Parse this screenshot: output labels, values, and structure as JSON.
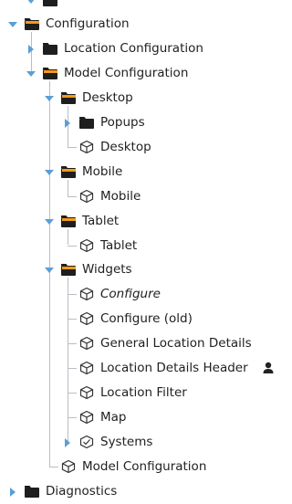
{
  "tree": {
    "items": [
      {
        "label": "",
        "level": 1,
        "kind": "folder",
        "twisty": "expanded",
        "italic": false,
        "top_cut": true
      },
      {
        "label": "Configuration",
        "level": 0,
        "kind": "folder-open",
        "twisty": "expanded",
        "italic": false
      },
      {
        "label": "Location Configuration",
        "level": 1,
        "kind": "folder",
        "twisty": "collapsed",
        "italic": false
      },
      {
        "label": "Model Configuration",
        "level": 1,
        "kind": "folder-open",
        "twisty": "expanded",
        "italic": false
      },
      {
        "label": "Desktop",
        "level": 2,
        "kind": "folder-open",
        "twisty": "expanded",
        "italic": false
      },
      {
        "label": "Popups",
        "level": 3,
        "kind": "folder",
        "twisty": "collapsed",
        "italic": false
      },
      {
        "label": "Desktop",
        "level": 3,
        "kind": "view",
        "twisty": "none",
        "italic": false
      },
      {
        "label": "Mobile",
        "level": 2,
        "kind": "folder-open",
        "twisty": "expanded",
        "italic": false
      },
      {
        "label": "Mobile",
        "level": 3,
        "kind": "view",
        "twisty": "none",
        "italic": false
      },
      {
        "label": "Tablet",
        "level": 2,
        "kind": "folder-open",
        "twisty": "expanded",
        "italic": false
      },
      {
        "label": "Tablet",
        "level": 3,
        "kind": "view",
        "twisty": "none",
        "italic": false
      },
      {
        "label": "Widgets",
        "level": 2,
        "kind": "folder-open",
        "twisty": "expanded",
        "italic": false
      },
      {
        "label": "Configure",
        "level": 3,
        "kind": "view",
        "twisty": "none",
        "italic": true
      },
      {
        "label": "Configure (old)",
        "level": 3,
        "kind": "view",
        "twisty": "none",
        "italic": false
      },
      {
        "label": "General Location Details",
        "level": 3,
        "kind": "view",
        "twisty": "none",
        "italic": false
      },
      {
        "label": "Location Details Header",
        "level": 3,
        "kind": "view",
        "twisty": "none",
        "italic": false,
        "badge": "user-icon"
      },
      {
        "label": "Location Filter",
        "level": 3,
        "kind": "view",
        "twisty": "none",
        "italic": false
      },
      {
        "label": "Map",
        "level": 3,
        "kind": "view",
        "twisty": "none",
        "italic": false
      },
      {
        "label": "Systems",
        "level": 3,
        "kind": "view-checked",
        "twisty": "collapsed",
        "italic": false
      },
      {
        "label": "Model Configuration",
        "level": 2,
        "kind": "view",
        "twisty": "none",
        "italic": false
      },
      {
        "label": "Diagnostics",
        "level": 0,
        "kind": "folder",
        "twisty": "collapsed",
        "italic": false
      }
    ]
  },
  "colors": {
    "folder": "#1e1e1e",
    "folder_open_top": "#f39a1b",
    "twisty": "#5a9fd6",
    "guide": "#b9bec4",
    "view_stroke": "#333333",
    "text": "#1f1f1f"
  },
  "icons": {
    "folder": "folder-icon",
    "folder-open": "folder-open-icon",
    "view": "view-icon",
    "view-checked": "view-checked-icon",
    "expanded": "chevron-down-icon",
    "collapsed": "chevron-right-icon"
  }
}
